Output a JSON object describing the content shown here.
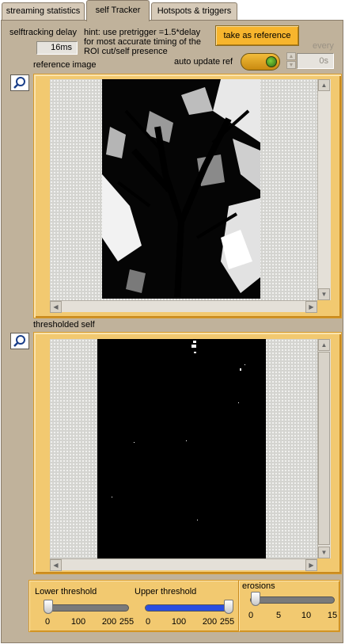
{
  "tabs": [
    {
      "label": "streaming statistics",
      "active": false
    },
    {
      "label": "self Tracker",
      "active": true
    },
    {
      "label": "Hotspots & triggers",
      "active": false
    }
  ],
  "controls": {
    "selftracking_delay_label": "selftracking delay",
    "selftracking_delay_value": "16ms",
    "hint_text": "hint: use pretrigger =1.5*delay\nfor most accurate timing of the\nROI cut/self presence",
    "take_reference_label": "take as reference",
    "every_label": "every",
    "auto_update_label": "auto update ref",
    "auto_update_interval": "0s"
  },
  "reference_image": {
    "label": "reference image",
    "zoom_icon": "magnifier-icon"
  },
  "thresholded_self": {
    "label": "thresholded self",
    "zoom_icon": "magnifier-icon"
  },
  "sliders": [
    {
      "label": "Lower threshold",
      "value": 10,
      "min": 0,
      "max": 255,
      "ticks": [
        "0",
        "100",
        "200",
        "255"
      ]
    },
    {
      "label": "Upper threshold",
      "value": 255,
      "min": 0,
      "max": 255,
      "ticks": [
        "0",
        "100",
        "200",
        "255"
      ]
    },
    {
      "label": "erosions",
      "value": 1,
      "min": 0,
      "max": 15,
      "ticks": [
        "0",
        "5",
        "10",
        "15"
      ]
    }
  ],
  "colors": {
    "panel": "#c0b29b",
    "frame": "#f2c970",
    "button": "#f7b52d",
    "slider_fill": "#2a4ee0"
  }
}
